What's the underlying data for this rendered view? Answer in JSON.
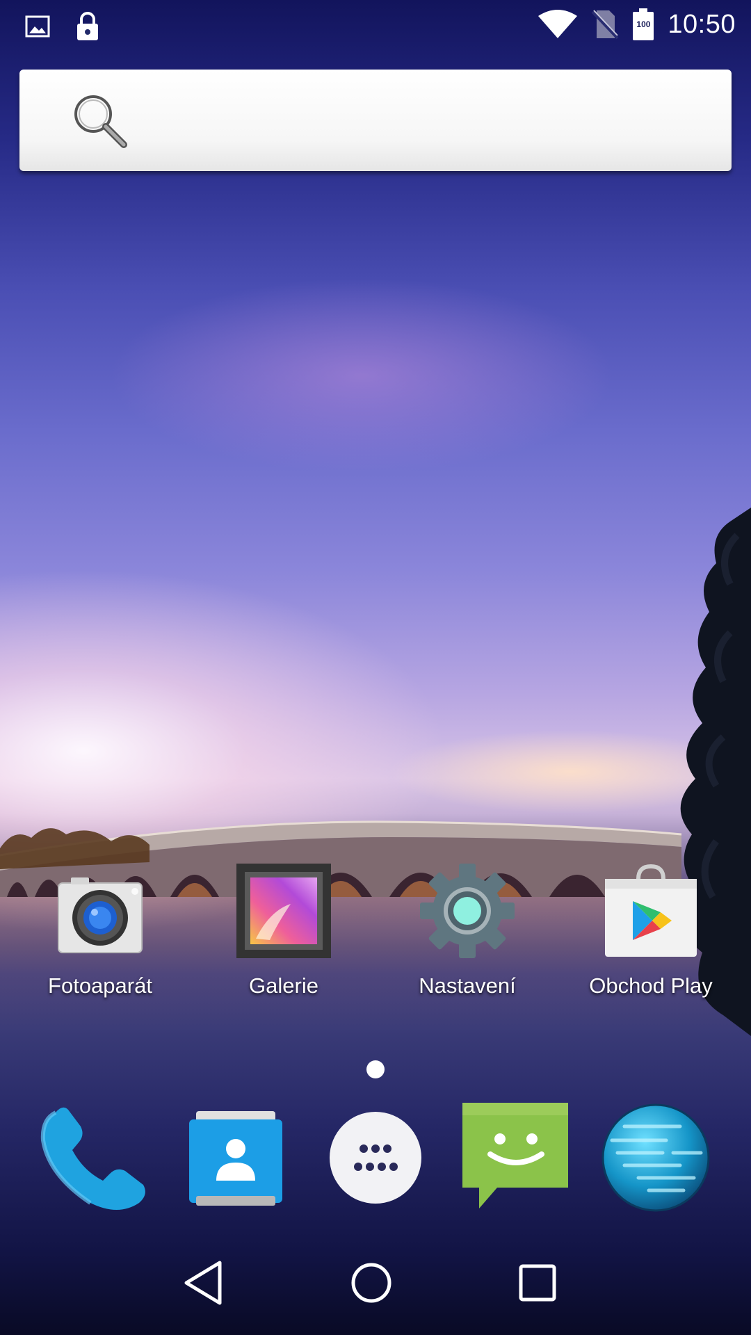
{
  "status_bar": {
    "time": "10:50",
    "battery_level": "100",
    "icons": [
      "image-notification-icon",
      "lock-icon",
      "wifi-icon",
      "no-sim-icon",
      "battery-icon"
    ]
  },
  "search": {
    "placeholder": ""
  },
  "home_apps": [
    {
      "label": "Fotoaparát",
      "icon": "camera-icon"
    },
    {
      "label": "Galerie",
      "icon": "gallery-icon"
    },
    {
      "label": "Nastavení",
      "icon": "settings-icon"
    },
    {
      "label": "Obchod Play",
      "icon": "play-store-icon"
    }
  ],
  "page_indicator": {
    "pages": 1,
    "current": 1
  },
  "dock": [
    {
      "icon": "phone-icon"
    },
    {
      "icon": "contacts-icon"
    },
    {
      "icon": "app-drawer-icon"
    },
    {
      "icon": "messaging-icon"
    },
    {
      "icon": "browser-icon"
    }
  ],
  "nav_bar": [
    "back-icon",
    "home-icon",
    "recents-icon"
  ],
  "colors": {
    "phone_blue": "#1fa3e0",
    "contacts_blue": "#1c9ee6",
    "messaging_green": "#8bc34a",
    "settings_teal": "#8ff0e0"
  }
}
